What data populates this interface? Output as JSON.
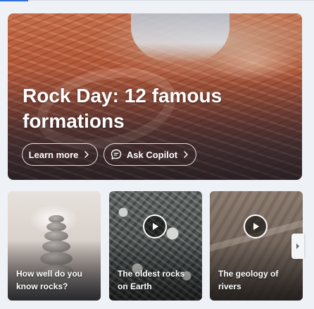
{
  "hero": {
    "title": "Rock Day: 12 famous formations",
    "learn_more_label": "Learn more",
    "ask_copilot_label": "Ask Copilot",
    "image": "wave-sandstone-rock-formation"
  },
  "cards": [
    {
      "title": "How well do you know rocks?",
      "image": "stacked-stones",
      "has_play": false
    },
    {
      "title": "The oldest rocks on Earth",
      "image": "granite-rock-closeup",
      "has_play": true
    },
    {
      "title": "The geology of rivers",
      "image": "eroded-mountain-valley",
      "has_play": true
    }
  ],
  "icons": {
    "chevron": "chevron-right-icon",
    "chat": "chat-bubble-icon",
    "play": "play-icon"
  },
  "colors": {
    "accent": "#2f6fde",
    "background": "#eef1f6"
  }
}
